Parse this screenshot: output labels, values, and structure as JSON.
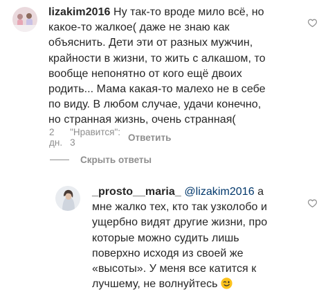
{
  "comment1": {
    "username": "lizakim2016",
    "lines": [
      "Ну так-то вроде мило всё, но",
      "какое-то жалкое( даже не знаю как",
      "объяснить. Дети эти от разных мужчин,",
      "крайности в жизни, то жить с алкашом, то",
      "вообще непонятно от кого ещё двоих",
      "родить... Мама какая-то малехо не в себе",
      "по виду. В любом случае, удачи конечно,",
      "но странная жизнь, очень странная("
    ],
    "time": "2 дн.",
    "likes": "\"Нравится\": 3",
    "reply_label": "Ответить"
  },
  "hide_replies_label": "Скрыть ответы",
  "comment2": {
    "username": "_prosto__maria_",
    "mention": "@lizakim2016",
    "first_tail": "а",
    "lines": [
      "мне жалко тех, кто так узколобо и",
      "ущербно видят другие жизни, про",
      "которые можно судить лишь",
      "поверхно исходя из своей же",
      "«высоты». У меня все катится к",
      "лучшему, не волнуйтесь"
    ],
    "emoji": "winking-face"
  },
  "icons": {
    "like": "heart-outline-icon"
  }
}
